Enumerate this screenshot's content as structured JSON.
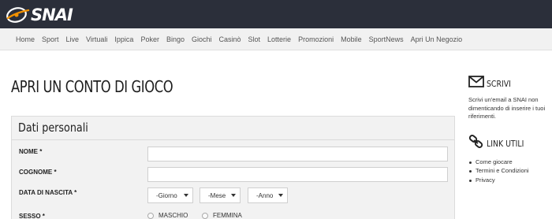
{
  "header": {
    "logo_text": "SNAI"
  },
  "nav": {
    "items": [
      "Home",
      "Sport",
      "Live",
      "Virtuali",
      "Ippica",
      "Poker",
      "Bingo",
      "Giochi",
      "Casinò",
      "Slot",
      "Lotterie",
      "Promozioni",
      "Mobile",
      "SportNews",
      "Apri Un Negozio"
    ]
  },
  "main": {
    "page_title": "APRI UN CONTO DI GIOCO",
    "panel_title": "Dati personali",
    "fields": {
      "nome_label": "NOME *",
      "nome_value": "",
      "cognome_label": "COGNOME *",
      "cognome_value": "",
      "dob_label": "DATA DI NASCITA *",
      "dob_day": "-Giorno",
      "dob_month": "-Mese",
      "dob_year": "-Anno",
      "sesso_label": "SESSO *",
      "sesso_options": [
        "MASCHIO",
        "FEMMINA"
      ]
    }
  },
  "sidebar": {
    "scrivi_title": "SCRIVI",
    "scrivi_text": "Scrivi un'email a SNAI non dimenticando di inserire i tuoi riferimenti.",
    "links_title": "LINK UTILI",
    "links": [
      "Come giocare",
      "Termini e Condizioni",
      "Privacy"
    ]
  },
  "colors": {
    "topbar": "#2b2f3a",
    "logo_accent": "#f39200",
    "nav_bg": "#f1f1f1",
    "panel_bg": "#f2f2f2"
  },
  "icons": {
    "scrivi": "envelope-icon",
    "links": "chain-link-icon",
    "logo": "snai-orbit-logo"
  }
}
